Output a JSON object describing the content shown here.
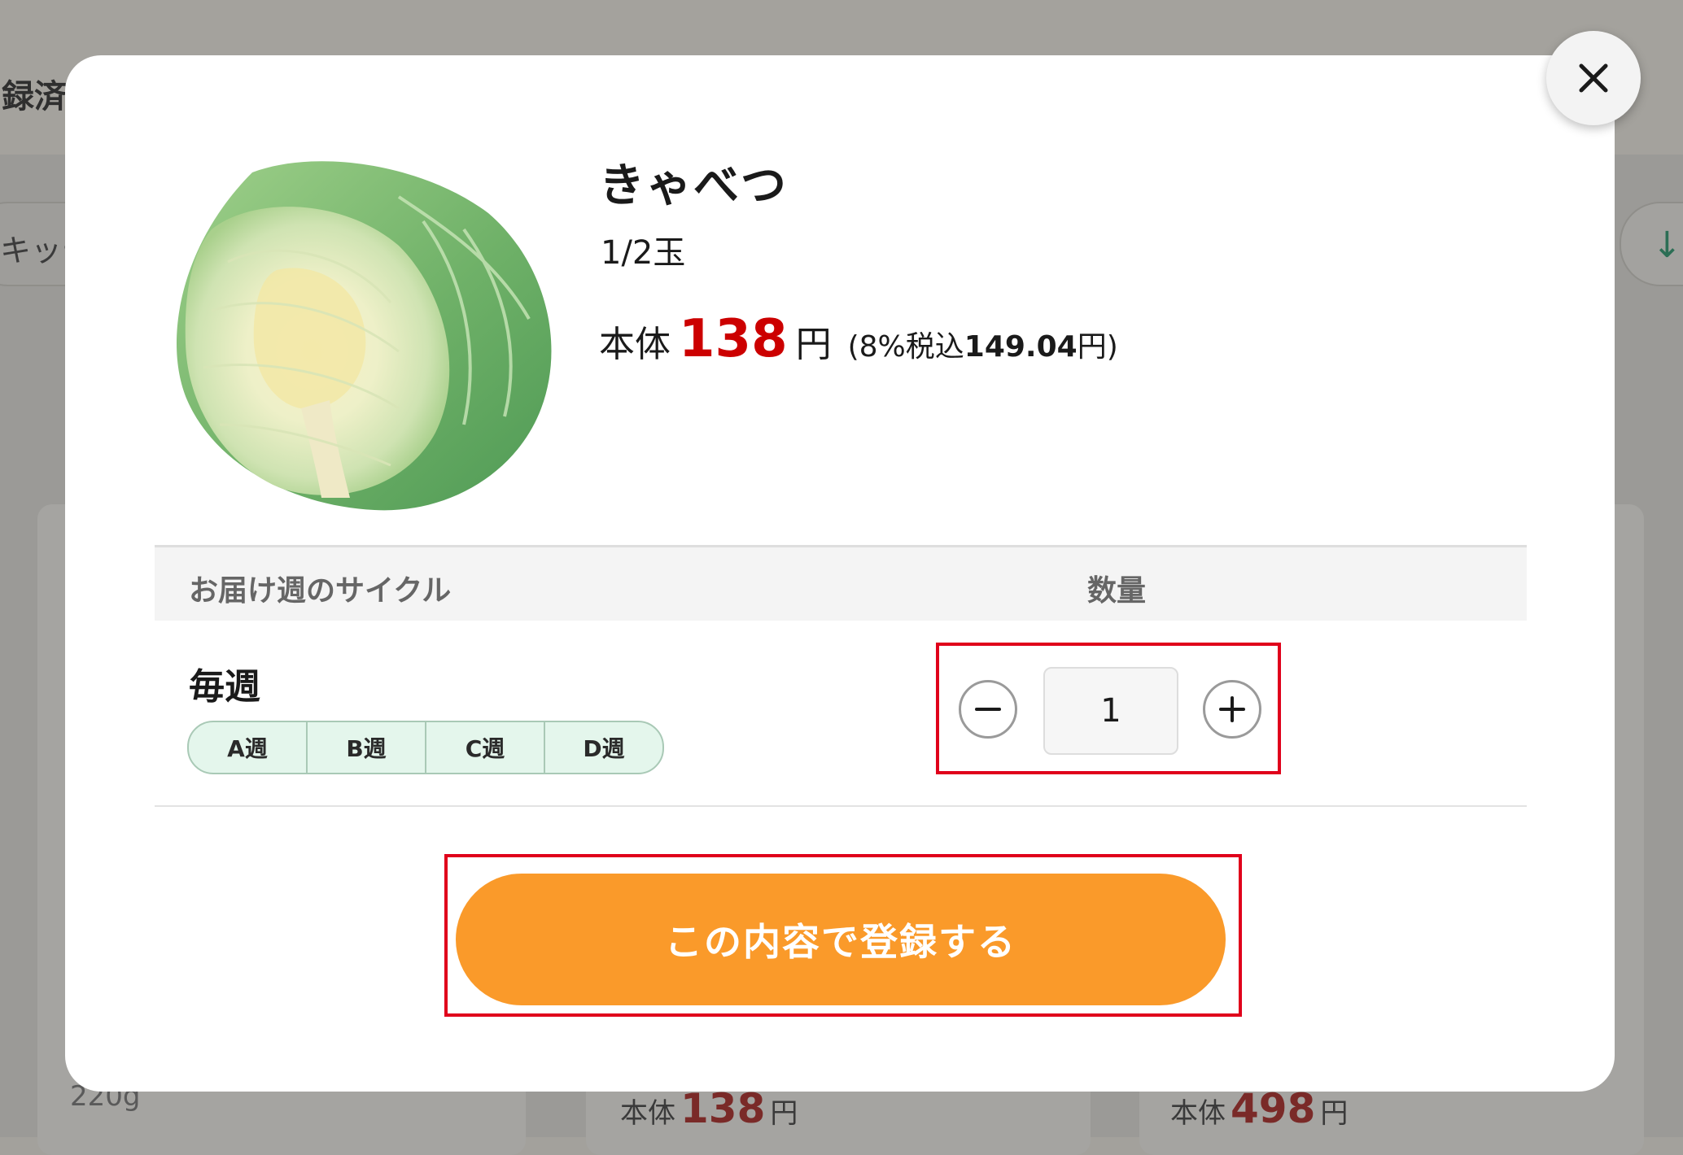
{
  "background": {
    "registered_label": "録済",
    "filter_label": "キッテ",
    "weight_text": "220g",
    "cards": [
      {
        "price_label": "本体",
        "price_value": "138",
        "price_unit": "円"
      },
      {
        "price_label": "本体",
        "price_value": "498",
        "price_unit": "円"
      }
    ]
  },
  "modal": {
    "close_label": "閉じる",
    "product": {
      "name": "きゃべつ",
      "size": "1/2玉",
      "price_label": "本体",
      "price_value": "138",
      "price_unit": "円",
      "tax_prefix": "(8%税込",
      "tax_value": "149.04",
      "tax_suffix": "円)"
    },
    "table": {
      "col_cycle": "お届け週のサイクル",
      "col_quantity": "数量",
      "cycle_title": "毎週",
      "weeks": [
        "A週",
        "B週",
        "C週",
        "D週"
      ],
      "quantity": "1"
    },
    "register_button": "この内容で登録する"
  },
  "colors": {
    "accent_orange": "#fa9a2a",
    "price_red": "#cc0000",
    "highlight_red": "#e0001b",
    "week_chip_bg": "#e4f6ec"
  }
}
